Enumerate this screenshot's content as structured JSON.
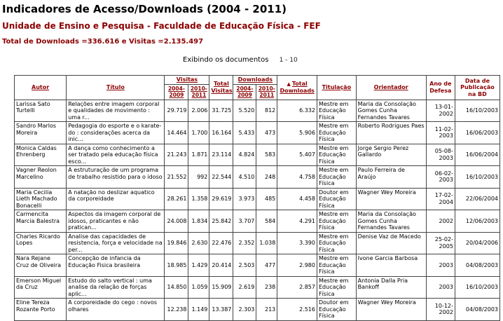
{
  "header": {
    "title": "Indicadores de Acesso/Downloads (2004 - 2011)",
    "unit": "Unidade de Ensino e Pesquisa - Faculdade de Educação Física - FEF",
    "totals": "Total de Downloads =336.616 e Visitas =2.135.497"
  },
  "paging": {
    "label": "Exibindo os documentos",
    "range": "1 - 10"
  },
  "columns": {
    "autor": "Autor",
    "titulo": "Título",
    "visitas": "Visitas",
    "visitas_a": "2004-2009",
    "visitas_b": "2010-2011",
    "total_visitas": "Total Visitas",
    "downloads": "Downloads",
    "downloads_a": "2004-2009",
    "downloads_b": "2010-2011",
    "total_downloads": "Total Downloads",
    "titulacao": "Titulação",
    "orientador": "Orientador",
    "ano_defesa": "Ano de Defesa",
    "data_publicacao": "Data de Publicação na BD"
  },
  "icons": {
    "sort": "sort-arrow-icon"
  },
  "rows": [
    {
      "autor": "Larissa Sato Turtelli",
      "titulo": "Relações entre imagem corporal e qualidades de movimento : uma r...",
      "v1": "29.719",
      "v2": "2.006",
      "vt": "31.725",
      "d1": "5.520",
      "d2": "812",
      "dt": "6.332",
      "titulacao": "Mestre em Educação Física",
      "orientador": "Maria da Consolação Gomes Cunha Fernandes Tavares",
      "ano": "13-01-2002",
      "pub": "16/10/2003"
    },
    {
      "autor": "Sandro Marlos Moreira",
      "titulo": "Pedagogia do esporte e o karate-do : considerações acerca da inic...",
      "v1": "14.464",
      "v2": "1.700",
      "vt": "16.164",
      "d1": "5.433",
      "d2": "473",
      "dt": "5.906",
      "titulacao": "Mestre em Educação Física",
      "orientador": "Roberto Rodrigues Paes",
      "ano": "11-02-2003",
      "pub": "16/06/2003"
    },
    {
      "autor": "Monica Caldas Ehrenberg",
      "titulo": "A dança como conhecimento a ser tratado pela educação física esco...",
      "v1": "21.243",
      "v2": "1.871",
      "vt": "23.114",
      "d1": "4.824",
      "d2": "583",
      "dt": "5.407",
      "titulacao": "Mestre em Educação Física",
      "orientador": "Jorge Sergio Perez Gallardo",
      "ano": "05-08-2003",
      "pub": "16/06/2004"
    },
    {
      "autor": "Vagner Reolon Marcelino",
      "titulo": "A estruturação de um programa de trabalho resistido para o idoso",
      "v1": "21.552",
      "v2": "992",
      "vt": "22.544",
      "d1": "4.510",
      "d2": "248",
      "dt": "4.758",
      "titulacao": "Mestre em Educação Física",
      "orientador": "Paulo Ferreira de Araújo",
      "ano": "06-02-2003",
      "pub": "16/10/2003"
    },
    {
      "autor": "Maria Cecilia Lieth Machado Bonacelli",
      "titulo": "A natação no deslizar aquatico da corporeidade",
      "v1": "28.261",
      "v2": "1.358",
      "vt": "29.619",
      "d1": "3.973",
      "d2": "485",
      "dt": "4.458",
      "titulacao": "Doutor em Educação Física",
      "orientador": "Wagner Wey Moreira",
      "ano": "17-02-2004",
      "pub": "22/06/2004"
    },
    {
      "autor": "Carmencita Marcia Balestra",
      "titulo": "Aspectos da imagem corporal de idosos, praticantes e não pratican...",
      "v1": "24.008",
      "v2": "1.834",
      "vt": "25.842",
      "d1": "3.707",
      "d2": "584",
      "dt": "4.291",
      "titulacao": "Mestre em Educação Física",
      "orientador": "Maria da Consolação Gomes Cunha Fernandes Tavares",
      "ano": "2002",
      "pub": "12/06/2003"
    },
    {
      "autor": "Charles Ricardo Lopes",
      "titulo": "Analise das capacidades de resistencia, força e velocidade na per...",
      "v1": "19.846",
      "v2": "2.630",
      "vt": "22.476",
      "d1": "2.352",
      "d2": "1.038",
      "dt": "3.390",
      "titulacao": "Mestre em Educação Física",
      "orientador": "Denise Vaz de Macedo",
      "ano": "25-02-2005",
      "pub": "20/04/2006"
    },
    {
      "autor": "Nara Rejane Cruz de Oliveira",
      "titulo": "Concepção de infancia da Educação Fisica brasileira",
      "v1": "18.985",
      "v2": "1.429",
      "vt": "20.414",
      "d1": "2.503",
      "d2": "477",
      "dt": "2.980",
      "titulacao": "Mestre em Educação Física",
      "orientador": "Ivone Garcia Barbosa",
      "ano": "2003",
      "pub": "04/08/2003"
    },
    {
      "autor": "Emerson Miguel da Cruz",
      "titulo": "Estudo do salto vertical : uma analise da relação de forças aplic...",
      "v1": "14.850",
      "v2": "1.059",
      "vt": "15.909",
      "d1": "2.619",
      "d2": "238",
      "dt": "2.857",
      "titulacao": "Mestre em Educação Física",
      "orientador": "Antonia Dalla Pria Bankoff",
      "ano": "2003",
      "pub": "16/10/2003"
    },
    {
      "autor": "Eline Tereza Rozante Porto",
      "titulo": "A corporeidade do cego : novos olhares",
      "v1": "12.238",
      "v2": "1.149",
      "vt": "13.387",
      "d1": "2.303",
      "d2": "213",
      "dt": "2.516",
      "titulacao": "Doutor em Educação Física",
      "orientador": "Wagner Wey Moreira",
      "ano": "10-12-2002",
      "pub": "04/08/2003"
    }
  ]
}
